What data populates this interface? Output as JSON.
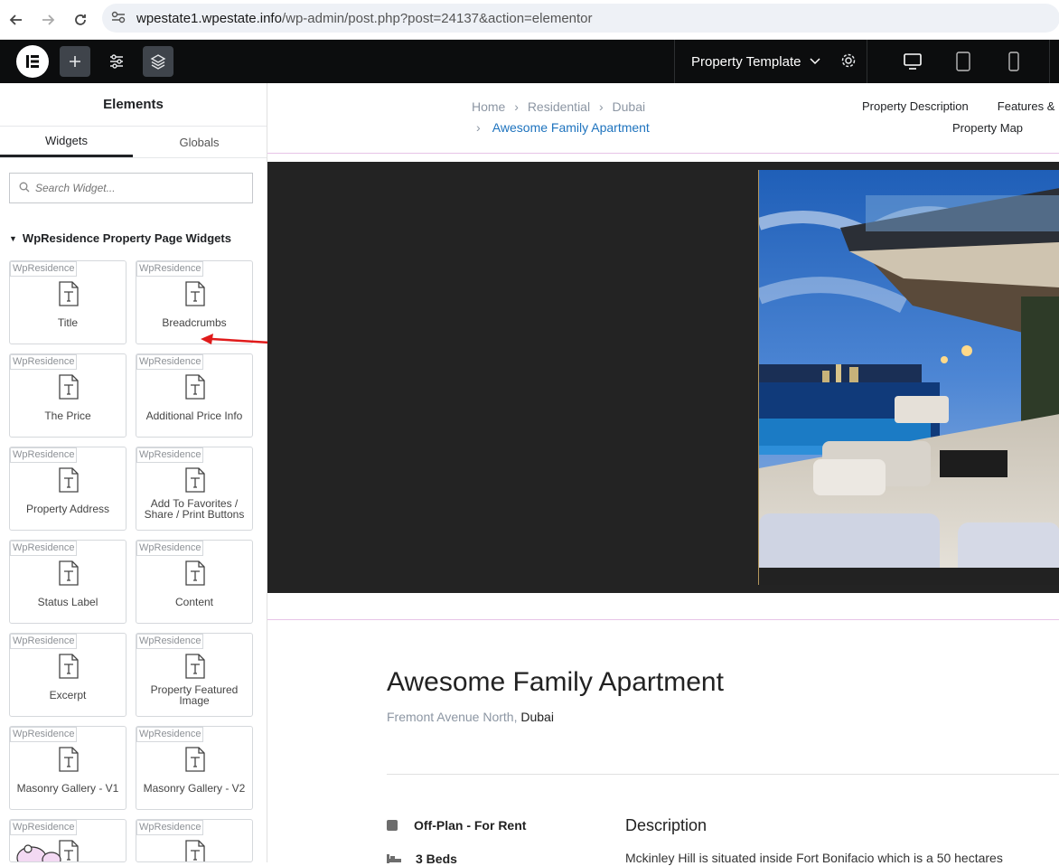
{
  "browser": {
    "url_host": "wpestate1.wpestate.info",
    "url_path": "/wp-admin/post.php?post=24137&action=elementor"
  },
  "topbar": {
    "template_label": "Property Template"
  },
  "panel": {
    "title": "Elements",
    "tabs": [
      "Widgets",
      "Globals"
    ],
    "search_placeholder": "Search Widget...",
    "category": "WpResidence Property Page Widgets",
    "widget_tag": "WpResidence",
    "widgets": [
      {
        "label": "Title"
      },
      {
        "label": "Breadcrumbs"
      },
      {
        "label": "The Price"
      },
      {
        "label": "Additional Price Info"
      },
      {
        "label": "Property Address"
      },
      {
        "label": "Add To Favorites / Share / Print Buttons"
      },
      {
        "label": "Status Label"
      },
      {
        "label": "Content"
      },
      {
        "label": "Excerpt"
      },
      {
        "label": "Property Featured Image"
      },
      {
        "label": "Masonry Gallery - V1"
      },
      {
        "label": "Masonry Gallery - V2"
      },
      {
        "label": ""
      },
      {
        "label": ""
      }
    ]
  },
  "canvas": {
    "breadcrumbs": [
      "Home",
      "Residential",
      "Dubai"
    ],
    "breadcrumb_current": "Awesome Family Apartment",
    "property_nav": [
      "Property Description",
      "Features &"
    ],
    "property_nav_2": "Property Map",
    "property_title": "Awesome Family Apartment",
    "address_street": "Fremont Avenue North, ",
    "address_city": "Dubai",
    "status": "Off-Plan - For Rent",
    "beds": "3 Beds",
    "description_title": "Description",
    "description_text": "Mckinley Hill is situated inside Fort Bonifacio which is a 50 hectares"
  }
}
